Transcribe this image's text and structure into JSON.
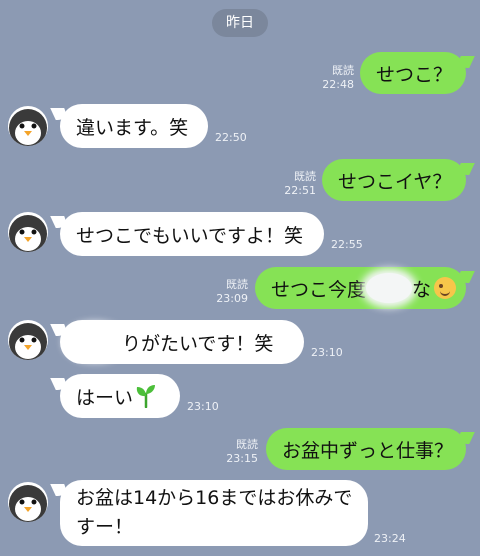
{
  "date_header": "昨日",
  "messages": [
    {
      "text": "せつこ？",
      "read": "既読",
      "time": "22:48"
    },
    {
      "text": "違います。笑",
      "time": "22:50"
    },
    {
      "text": "せつこイヤ？",
      "read": "既読",
      "time": "22:51"
    },
    {
      "text": "せつこでもいいですよ！笑",
      "time": "22:55"
    },
    {
      "text_before": "せつこ今度",
      "text_after": "な",
      "emoji": "winking-face",
      "read": "既読",
      "time": "23:09"
    },
    {
      "text": "りがたいです！笑",
      "time": "23:10"
    },
    {
      "text": "はーい",
      "emoji": "seedling",
      "time": "23:10"
    },
    {
      "text": "お盆中ずっと仕事？",
      "read": "既読",
      "time": "23:15"
    },
    {
      "line1": "お盆は14から16まではお休みで",
      "line2": "すー！",
      "time": "23:24"
    }
  ],
  "colors": {
    "background": "#8c9ab3",
    "outgoing_bubble": "#86e255",
    "incoming_bubble": "#ffffff"
  }
}
